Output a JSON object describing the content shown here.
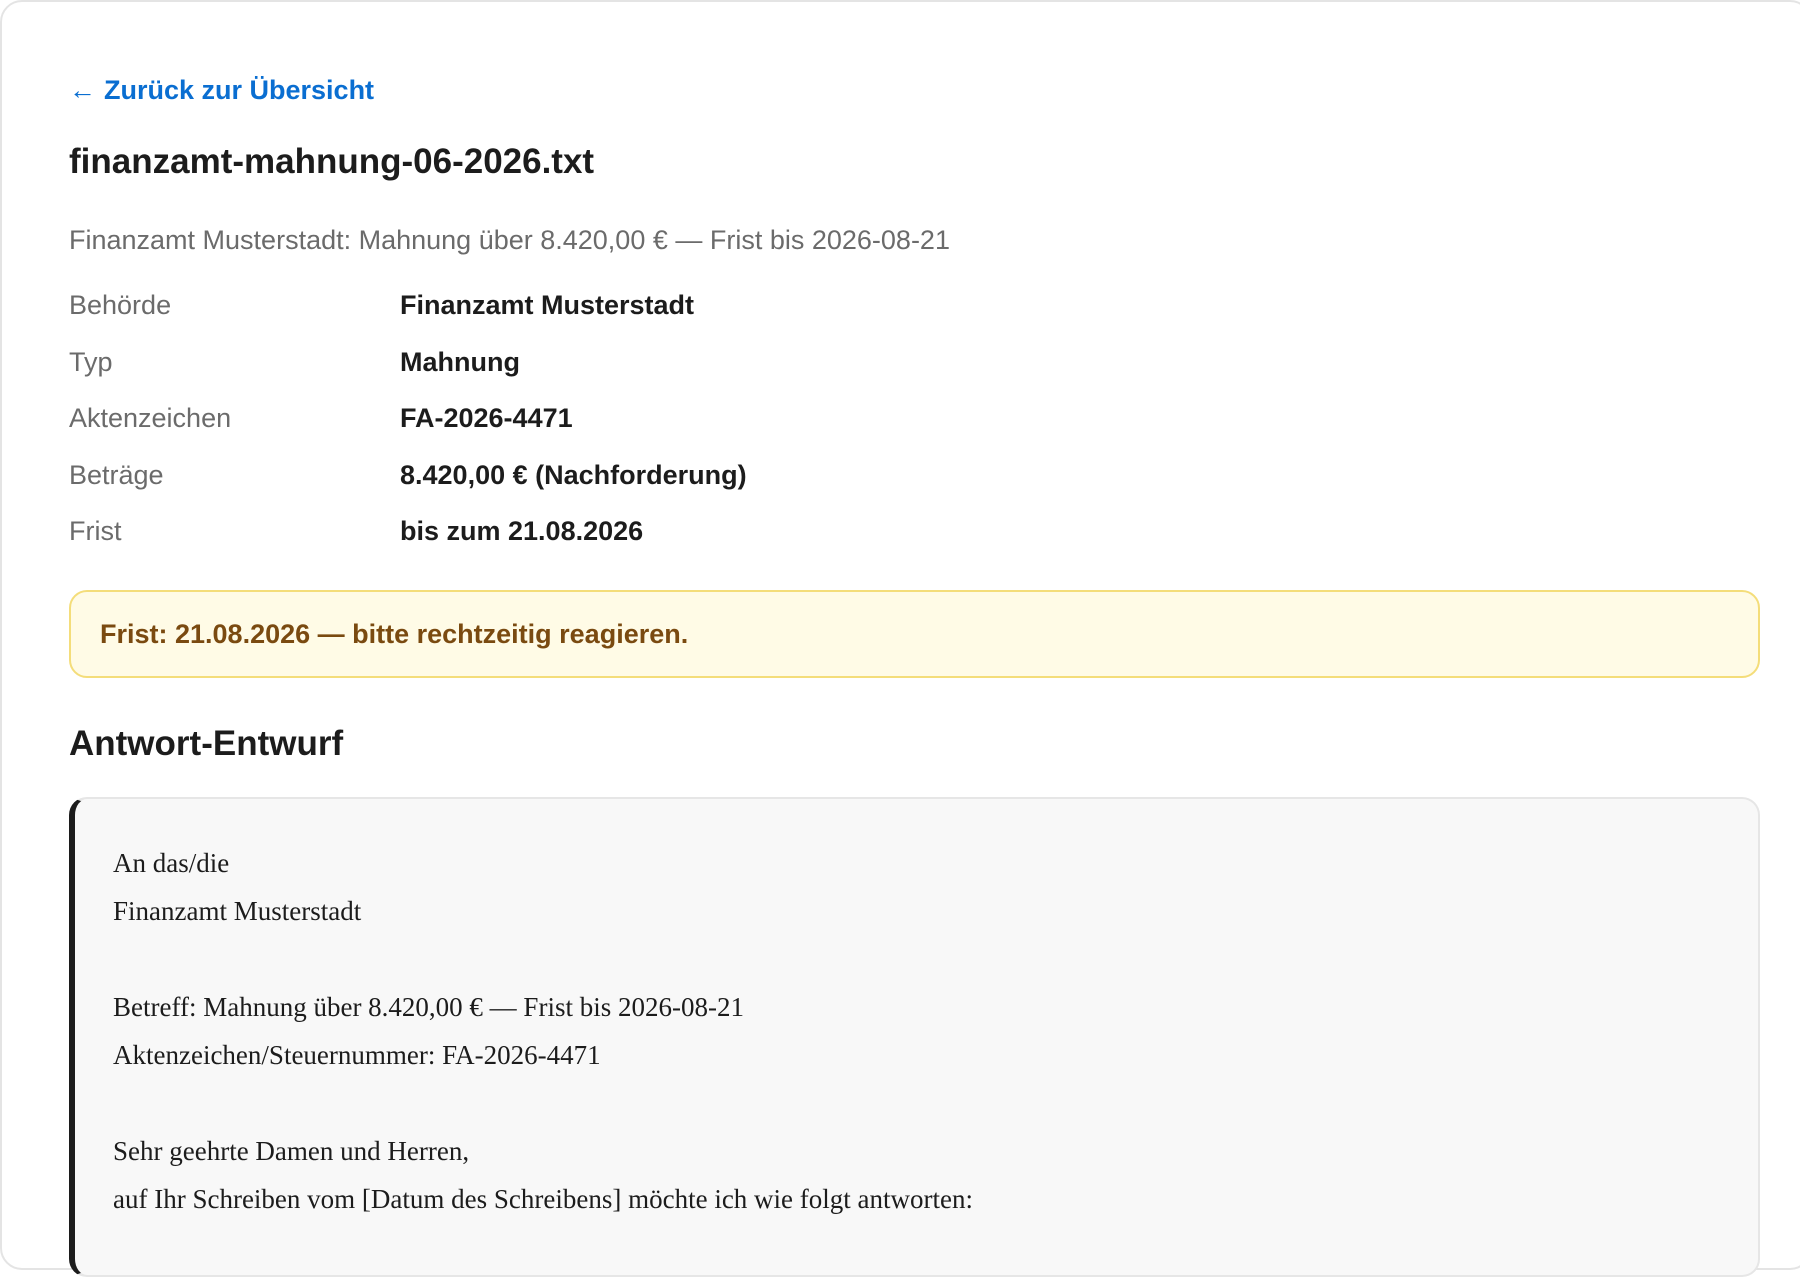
{
  "nav": {
    "back_arrow": "←",
    "back_label": "Zurück zur Übersicht"
  },
  "document": {
    "filename": "finanzamt-mahnung-06-2026.txt",
    "summary": "Finanzamt Musterstadt: Mahnung über 8.420,00 € — Frist bis 2026-08-21"
  },
  "meta": [
    {
      "label": "Behörde",
      "value": "Finanzamt Musterstadt"
    },
    {
      "label": "Typ",
      "value": "Mahnung"
    },
    {
      "label": "Aktenzeichen",
      "value": "FA-2026-4471"
    },
    {
      "label": "Beträge",
      "value": "8.420,00 € (Nachforderung)"
    },
    {
      "label": "Frist",
      "value": "bis zum 21.08.2026"
    }
  ],
  "deadline_notice": "Frist: 21.08.2026 — bitte rechtzeitig reagieren.",
  "draft": {
    "heading": "Antwort-Entwurf",
    "lines": [
      "An das/die",
      "Finanzamt Musterstadt",
      "",
      "Betreff: Mahnung über 8.420,00 € — Frist bis 2026-08-21",
      "Aktenzeichen/Steuernummer: FA-2026-4471",
      "",
      "Sehr geehrte Damen und Herren,",
      "auf Ihr Schreiben vom [Datum des Schreibens] möchte ich wie folgt antworten:"
    ]
  },
  "colors": {
    "link": "#0a6ed1",
    "notice_bg": "#fffbe6",
    "notice_border": "#f4dd7a",
    "notice_text": "#7a4a10"
  }
}
